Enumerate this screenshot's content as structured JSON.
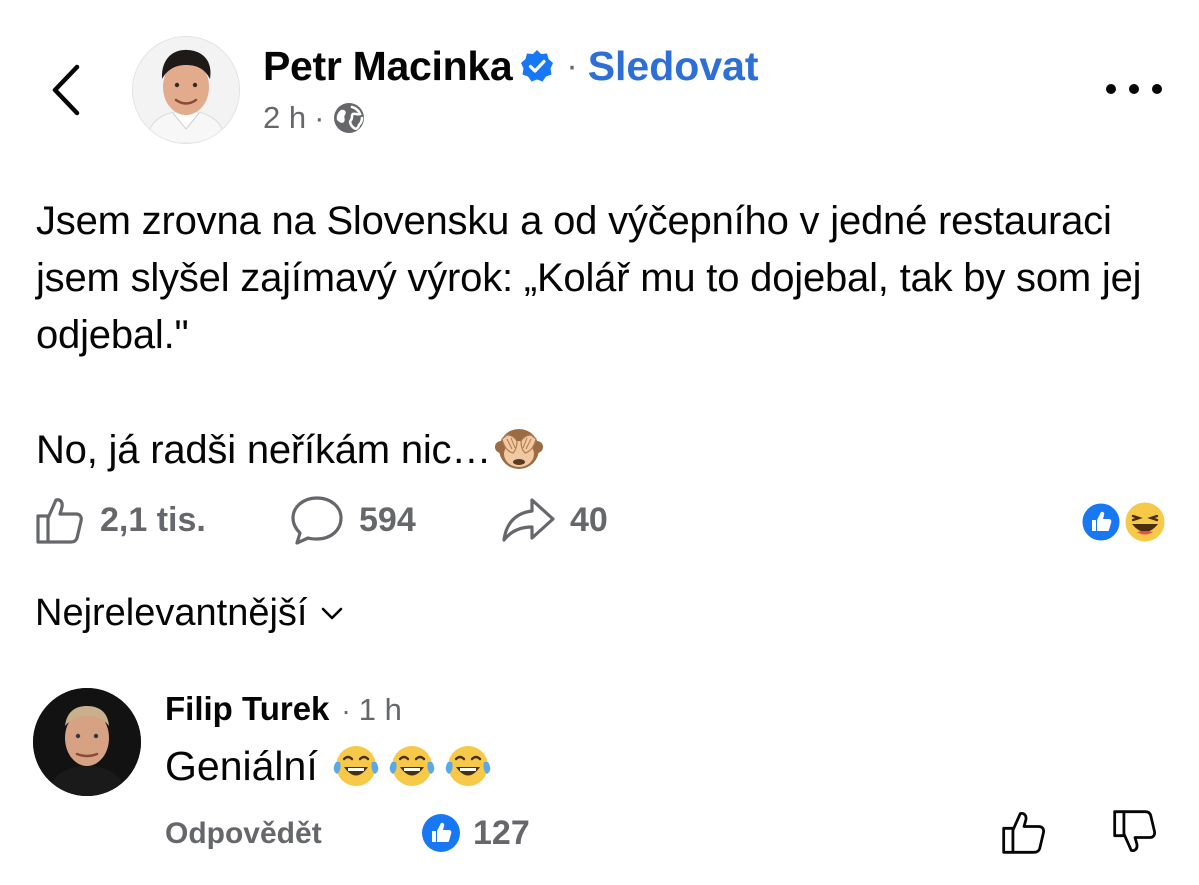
{
  "header": {
    "author_name": "Petr Macinka",
    "separator": "·",
    "follow_label": "Sledovat",
    "time": "2 h",
    "audience_icon": "globe-icon"
  },
  "post": {
    "paragraph_1": "Jsem zrovna na Slovensku a od výčepního v jedné restauraci jsem slyšel zajímavý výrok: „Kolář mu to dojebal, tak by som jej odjebal.\"",
    "paragraph_2": "No, já radši neříkám nic…",
    "trailing_emoji": "see-no-evil-monkey"
  },
  "actions": {
    "likes": "2,1 tis.",
    "comments": "594",
    "shares": "40",
    "reactions": [
      "like",
      "haha"
    ],
    "colors": {
      "like_blue": "#1877f2",
      "muted": "#65676b",
      "follow_blue": "#2d6fd6"
    }
  },
  "sort": {
    "label": "Nejrelevantnější"
  },
  "comment": {
    "author": "Filip Turek",
    "separator": "·",
    "time": "1 h",
    "text": "Geniální",
    "emojis": [
      "joy",
      "joy",
      "joy"
    ],
    "reply_label": "Odpovědět",
    "like_count": "127"
  }
}
